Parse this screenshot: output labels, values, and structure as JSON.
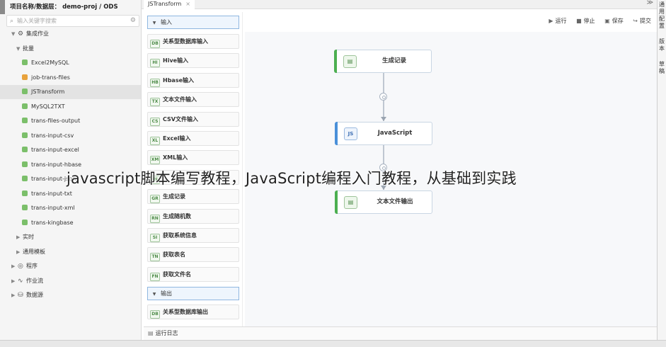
{
  "project_header": "项目名称/数据层： demo-proj / ODS",
  "search": {
    "placeholder": "输入关键字搜索"
  },
  "tree": [
    {
      "level": 1,
      "caret": "▼",
      "icon": "gear-icon",
      "label": "集成作业"
    },
    {
      "level": 2,
      "caret": "▼",
      "label": "批量"
    },
    {
      "level": 3,
      "label": "Excel2MySQL"
    },
    {
      "level": 3,
      "label": "job-trans-files"
    },
    {
      "level": 3,
      "label": "JSTransform",
      "selected": true
    },
    {
      "level": 3,
      "label": "MySQL2TXT"
    },
    {
      "level": 3,
      "label": "trans-files-output"
    },
    {
      "level": 3,
      "label": "trans-input-csv"
    },
    {
      "level": 3,
      "label": "trans-input-excel"
    },
    {
      "level": 3,
      "label": "trans-input-hbase"
    },
    {
      "level": 3,
      "label": "trans-input-json"
    },
    {
      "level": 3,
      "label": "trans-input-txt"
    },
    {
      "level": 3,
      "label": "trans-input-xml"
    },
    {
      "level": 3,
      "label": "trans-kingbase"
    },
    {
      "level": 2,
      "caret": "▶",
      "label": "实时"
    },
    {
      "level": 2,
      "caret": "▶",
      "label": "通用模板"
    },
    {
      "level": 1,
      "caret": "▶",
      "icon": "program-icon",
      "label": "程序"
    },
    {
      "level": 1,
      "caret": "▶",
      "icon": "workflow-icon",
      "label": "作业流"
    },
    {
      "level": 1,
      "caret": "▶",
      "icon": "datasource-icon",
      "label": "数据源"
    }
  ],
  "tab": {
    "label": "JSTransform",
    "close": "×"
  },
  "tab_more": "≫",
  "palette": {
    "input_section": "输入",
    "input_items": [
      {
        "icon": "db-input-icon",
        "glyph": "DB",
        "label": "关系型数据库输入"
      },
      {
        "icon": "hive-icon",
        "glyph": "HI",
        "label": "Hive输入"
      },
      {
        "icon": "hbase-icon",
        "glyph": "HB",
        "label": "Hbase输入"
      },
      {
        "icon": "text-file-icon",
        "glyph": "TX",
        "label": "文本文件输入"
      },
      {
        "icon": "csv-icon",
        "glyph": "CS",
        "label": "CSV文件输入"
      },
      {
        "icon": "excel-icon",
        "glyph": "XL",
        "label": "Excel输入"
      },
      {
        "icon": "xml-icon",
        "glyph": "XM",
        "label": "XML输入"
      },
      {
        "icon": "json-icon",
        "glyph": "JN",
        "label": ""
      },
      {
        "icon": "generate-records-icon",
        "glyph": "GR",
        "label": "生成记录"
      },
      {
        "icon": "random-icon",
        "glyph": "RN",
        "label": "生成随机数"
      },
      {
        "icon": "system-info-icon",
        "glyph": "SI",
        "label": "获取系统信息"
      },
      {
        "icon": "table-name-icon",
        "glyph": "TN",
        "label": "获取表名"
      },
      {
        "icon": "file-name-icon",
        "glyph": "FN",
        "label": "获取文件名"
      }
    ],
    "output_section": "输出",
    "output_items": [
      {
        "icon": "db-output-icon",
        "glyph": "DB",
        "label": "关系型数据库输出"
      }
    ]
  },
  "toolbar": {
    "run": "运行",
    "run_icon": "▶",
    "stop": "停止",
    "stop_icon": "■",
    "save": "保存",
    "save_icon": "▣",
    "submit": "提交",
    "submit_icon": "↪"
  },
  "nodes": [
    {
      "id": "generate",
      "label": "生成记录",
      "glyph": "▤",
      "accent": "#4caf50"
    },
    {
      "id": "javascript",
      "label": "JavaScript",
      "glyph": "JS",
      "accent": "#4a90d9"
    },
    {
      "id": "text-output",
      "label": "文本文件输出",
      "glyph": "▤",
      "accent": "#4caf50"
    }
  ],
  "log": {
    "label": "运行日志",
    "icon": "▤"
  },
  "right_panel": [
    "通用配置",
    "版本",
    "草稿"
  ],
  "overlay_caption": "javascript脚本编写教程，JavaScript编程入门教程，从基础到实践"
}
